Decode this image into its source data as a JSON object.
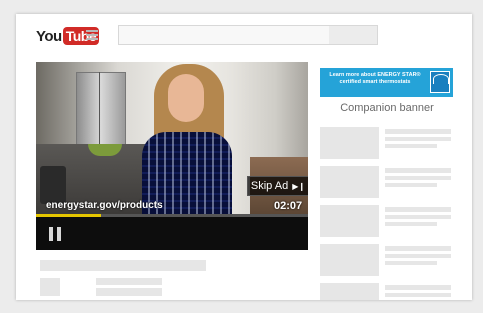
{
  "header": {
    "logo_you": "You",
    "logo_tube": "Tube",
    "search_placeholder": ""
  },
  "player": {
    "url_overlay": "energystar.gov/products",
    "skip_label": "Skip Ad",
    "skip_icon": "skip-next-icon",
    "time_remaining": "02:07",
    "progress_fraction": 0.24,
    "progress_color": "#e5c600",
    "pause_icon": "pause-icon"
  },
  "sidebar": {
    "ad_text": "Learn more about ENERGY STAR® certified smart thermostats",
    "ad_color": "#25a3d8",
    "companion_label": "Companion banner"
  },
  "colors": {
    "brand_red": "#d12b27",
    "placeholder_gray": "#e6e6e6"
  }
}
